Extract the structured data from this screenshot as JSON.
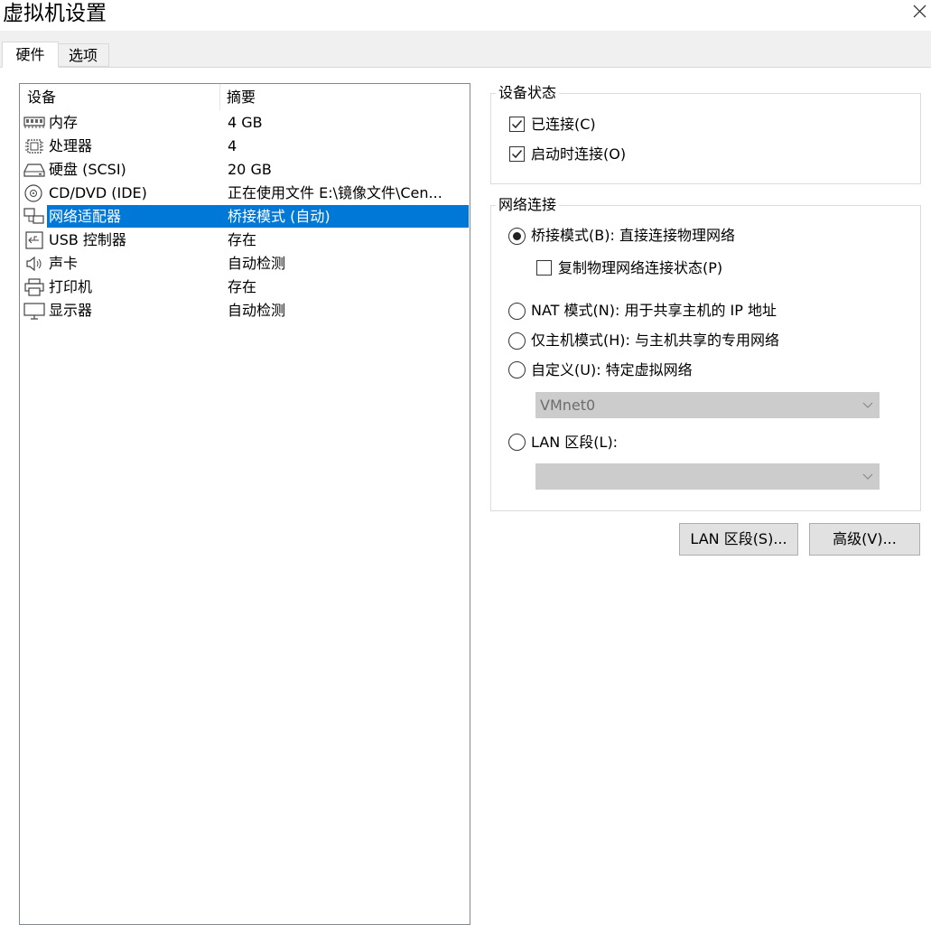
{
  "window": {
    "title": "虚拟机设置"
  },
  "tabs": [
    {
      "label": "硬件",
      "active": true
    },
    {
      "label": "选项",
      "active": false
    }
  ],
  "device_list": {
    "columns": [
      "设备",
      "摘要"
    ],
    "rows": [
      {
        "icon": "memory-icon",
        "name": "内存",
        "summary": "4 GB",
        "selected": false
      },
      {
        "icon": "cpu-icon",
        "name": "处理器",
        "summary": "4",
        "selected": false
      },
      {
        "icon": "hard-disk-icon",
        "name": "硬盘 (SCSI)",
        "summary": "20 GB",
        "selected": false
      },
      {
        "icon": "cd-dvd-icon",
        "name": "CD/DVD (IDE)",
        "summary": "正在使用文件 E:\\镜像文件\\Cen...",
        "selected": false
      },
      {
        "icon": "network-adapter-icon",
        "name": "网络适配器",
        "summary": "桥接模式 (自动)",
        "selected": true
      },
      {
        "icon": "usb-icon",
        "name": "USB 控制器",
        "summary": "存在",
        "selected": false
      },
      {
        "icon": "speaker-icon",
        "name": "声卡",
        "summary": "自动检测",
        "selected": false
      },
      {
        "icon": "printer-icon",
        "name": "打印机",
        "summary": "存在",
        "selected": false
      },
      {
        "icon": "monitor-icon",
        "name": "显示器",
        "summary": "自动检测",
        "selected": false
      }
    ]
  },
  "device_status": {
    "title": "设备状态",
    "connected": {
      "label": "已连接(C)",
      "checked": true
    },
    "connect_at_power_on": {
      "label": "启动时连接(O)",
      "checked": true
    }
  },
  "network": {
    "title": "网络连接",
    "bridged": {
      "label": "桥接模式(B): 直接连接物理网络",
      "selected": true
    },
    "replicate": {
      "label": "复制物理网络连接状态(P)",
      "checked": false
    },
    "nat": {
      "label": "NAT 模式(N): 用于共享主机的 IP 地址",
      "selected": false
    },
    "host_only": {
      "label": "仅主机模式(H): 与主机共享的专用网络",
      "selected": false
    },
    "custom": {
      "label": "自定义(U): 特定虚拟网络",
      "selected": false
    },
    "custom_value": "VMnet0",
    "lan_segment": {
      "label": "LAN 区段(L):",
      "selected": false
    },
    "lan_value": ""
  },
  "buttons": {
    "lan_segments": "LAN 区段(S)...",
    "advanced": "高级(V)..."
  },
  "colors": {
    "selection": "#0078d7",
    "disabled_combo": "#cccccc"
  }
}
